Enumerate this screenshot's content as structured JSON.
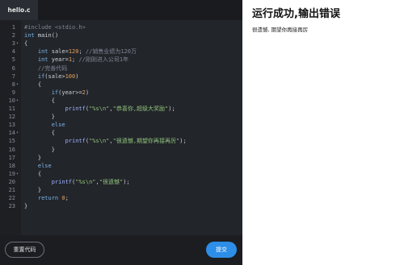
{
  "editor": {
    "tab_label": "hello.c",
    "lines": [
      {
        "no": "1",
        "fold": "",
        "html": "<span class=\"c-cmt\">#include &lt;stdio.h&gt;</span>"
      },
      {
        "no": "2",
        "fold": "",
        "html": "<span class=\"c-kw\">int</span> main()"
      },
      {
        "no": "3",
        "fold": "▾",
        "html": "{"
      },
      {
        "no": "4",
        "fold": "",
        "html": "    <span class=\"c-kw\">int</span> sale=<span class=\"c-num\">120</span>; <span class=\"c-cmt\">//销售业绩为120万</span>"
      },
      {
        "no": "5",
        "fold": "",
        "html": "    <span class=\"c-kw\">int</span> year=<span class=\"c-num\">1</span>; <span class=\"c-cmt\">//刚刚进入公司1年</span>"
      },
      {
        "no": "6",
        "fold": "",
        "html": "    <span class=\"c-cmt\">//完善代码</span>"
      },
      {
        "no": "7",
        "fold": "",
        "html": "    <span class=\"c-kw\">if</span>(sale&gt;<span class=\"c-num\">100</span>)"
      },
      {
        "no": "8",
        "fold": "▾",
        "html": "    {"
      },
      {
        "no": "9",
        "fold": "",
        "html": "        <span class=\"c-kw\">if</span>(year&gt;=<span class=\"c-num\">2</span>)"
      },
      {
        "no": "10",
        "fold": "▾",
        "html": "        {"
      },
      {
        "no": "11",
        "fold": "",
        "html": "            <span class=\"c-fn\">printf</span>(<span class=\"c-str\">\"%s\\n\"</span>,<span class=\"c-str\">\"恭喜你,超级大奖励\"</span>);"
      },
      {
        "no": "12",
        "fold": "",
        "html": "        }"
      },
      {
        "no": "13",
        "fold": "",
        "html": "        <span class=\"c-kw\">else</span>"
      },
      {
        "no": "14",
        "fold": "▾",
        "html": "        {"
      },
      {
        "no": "15",
        "fold": "",
        "html": "            <span class=\"c-fn\">printf</span>(<span class=\"c-str\">\"%s\\n\"</span>,<span class=\"c-str\">\"很遗憾,期望你再接再厉\"</span>);"
      },
      {
        "no": "16",
        "fold": "",
        "html": "        }"
      },
      {
        "no": "17",
        "fold": "",
        "html": "    }"
      },
      {
        "no": "18",
        "fold": "",
        "html": "    <span class=\"c-kw\">else</span>"
      },
      {
        "no": "19",
        "fold": "▾",
        "html": "    {"
      },
      {
        "no": "20",
        "fold": "",
        "html": "        <span class=\"c-fn\">printf</span>(<span class=\"c-str\">\"%s\\n\"</span>,<span class=\"c-str\">\"很遗憾\"</span>);"
      },
      {
        "no": "21",
        "fold": "",
        "html": "    }"
      },
      {
        "no": "22",
        "fold": "",
        "html": "    <span class=\"c-kw\">return</span> <span class=\"c-num\">0</span>;"
      },
      {
        "no": "23",
        "fold": "",
        "html": "}"
      }
    ]
  },
  "buttons": {
    "reset_label": "重置代码",
    "submit_label": "提交"
  },
  "output": {
    "title": "运行成功,输出错误",
    "text": "很遗憾, 期望你再接再厉"
  },
  "colors": {
    "editor_bg": "#22252a",
    "submit_bg": "#2d8ee8"
  }
}
